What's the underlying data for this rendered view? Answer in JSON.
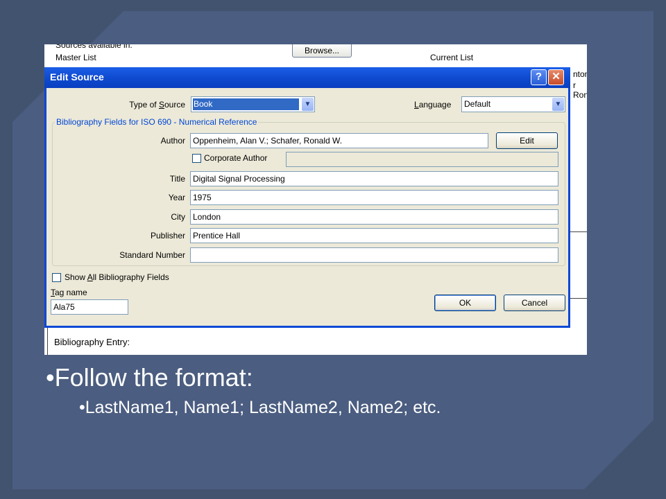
{
  "background": {
    "sources_available_in": "Sources available in:",
    "browse_label": "Browse...",
    "master_list_label": "Master List",
    "current_list_label": "Current List",
    "right_partial_1": "nton",
    "right_partial_2": "r Ron",
    "bibliography_entry_label": "Bibliography Entry:"
  },
  "dialog": {
    "title": "Edit Source",
    "help_glyph": "?",
    "close_glyph": "✕",
    "type_of_source_label": "Type of Source",
    "type_of_source_value": "Book",
    "language_label": "Language",
    "language_value": "Default",
    "group_title": "Bibliography Fields for ISO 690 - Numerical Reference",
    "author_label": "Author",
    "author_value": "Oppenheim, Alan V.; Schafer, Ronald W.",
    "edit_button": "Edit",
    "corporate_author_label": "Corporate Author",
    "corporate_author_checked": false,
    "fields": [
      {
        "label": "Title",
        "value": "Digital Signal Processing"
      },
      {
        "label": "Year",
        "value": "1975"
      },
      {
        "label": "City",
        "value": "London"
      },
      {
        "label": "Publisher",
        "value": "Prentice Hall"
      },
      {
        "label": "Standard Number",
        "value": ""
      }
    ],
    "show_all_label": "Show All Bibliography Fields",
    "show_all_checked": false,
    "tag_name_label": "Tag name",
    "tag_name_value": "Ala75",
    "ok_button": "OK",
    "cancel_button": "Cancel"
  },
  "slide": {
    "bullet_1": "•Follow the format:",
    "bullet_2": "•LastName1, Name1; LastName2, Name2; etc."
  },
  "colors": {
    "slide_background": "#4b5d80",
    "titlebar_blue": "#0a48d6",
    "dialog_face": "#ece9d8",
    "group_title_blue": "#0046d5"
  }
}
